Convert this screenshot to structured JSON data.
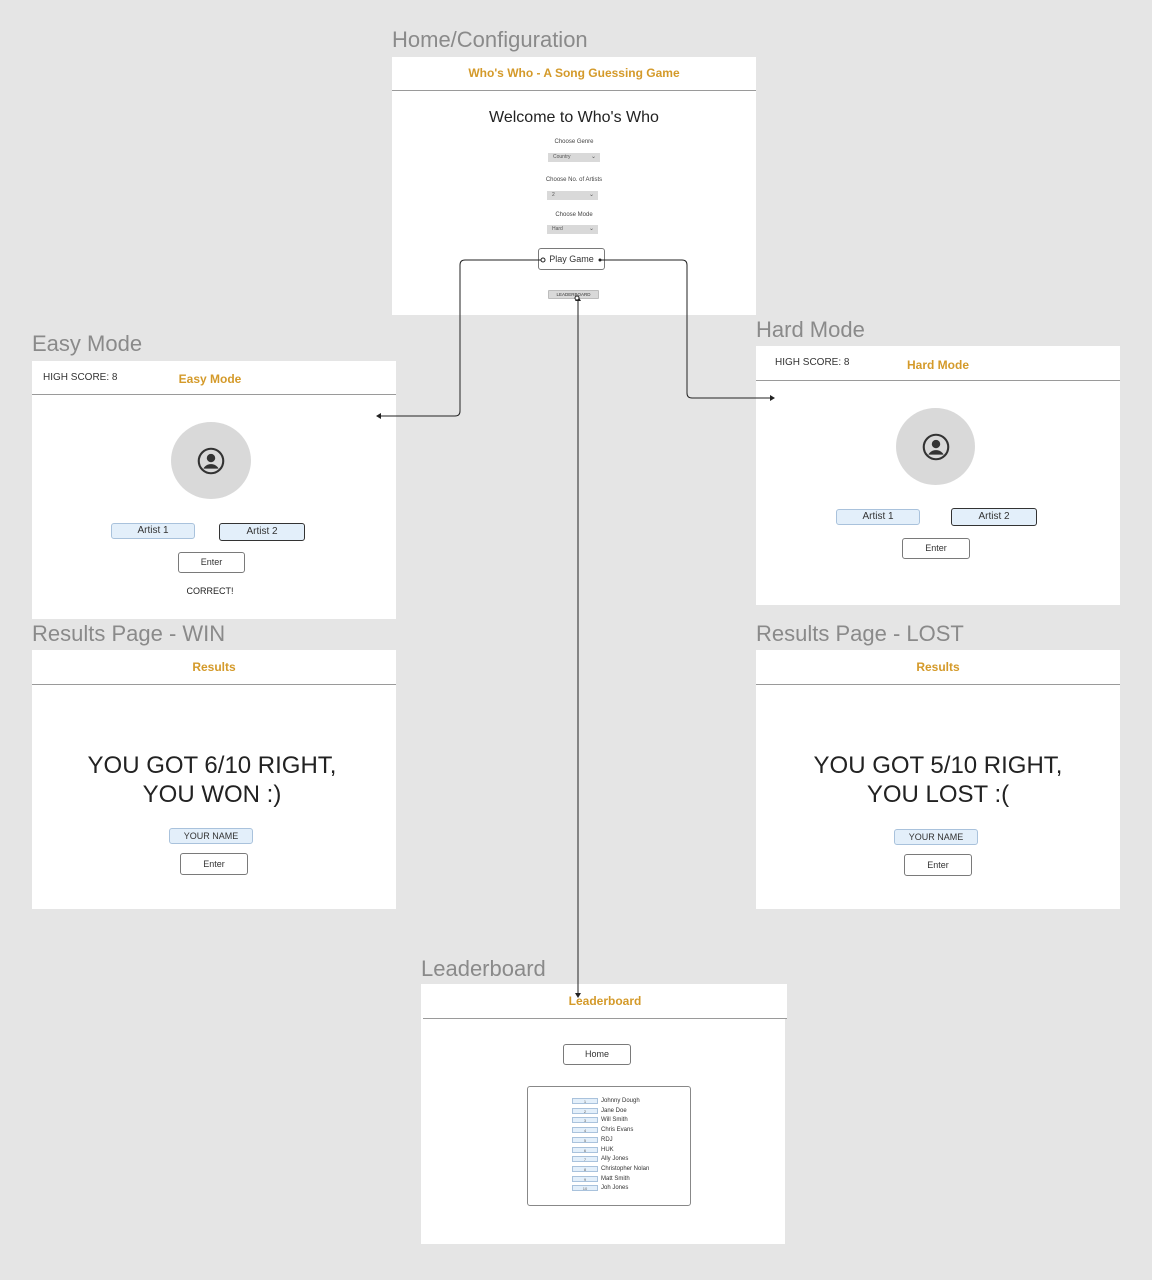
{
  "frames": {
    "home": {
      "label": "Home/Configuration",
      "header": "Who's Who - A Song Guessing Game",
      "welcome": "Welcome to Who's Who",
      "genre_label": "Choose Genre",
      "genre_value": "Country",
      "artists_label": "Choose No. of Artists",
      "artists_value": "2",
      "mode_label": "Choose Mode",
      "mode_value": "Hard",
      "play_button": "Play Game",
      "leaderboard_button": "LEADERBOARD"
    },
    "easy": {
      "label": "Easy Mode",
      "high_score": "HIGH SCORE: 8",
      "header": "Easy Mode",
      "artist1": "Artist 1",
      "artist2": "Artist 2",
      "enter": "Enter",
      "feedback": "CORRECT!"
    },
    "hard": {
      "label": "Hard Mode",
      "high_score": "HIGH SCORE: 8",
      "header": "Hard Mode",
      "artist1": "Artist 1",
      "artist2": "Artist 2",
      "enter": "Enter"
    },
    "win": {
      "label": "Results Page - WIN",
      "header": "Results",
      "line1": "YOU GOT 6/10 RIGHT,",
      "line2": "YOU WON :)",
      "name_field": "YOUR NAME",
      "enter": "Enter"
    },
    "lost": {
      "label": "Results Page - LOST",
      "header": "Results",
      "line1": "YOU GOT 5/10 RIGHT,",
      "line2": "YOU LOST :(",
      "name_field": "YOUR NAME",
      "enter": "Enter"
    },
    "leaderboard": {
      "label": "Leaderboard",
      "header": "Leaderboard",
      "home_button": "Home",
      "entries": [
        {
          "rank": "1",
          "name": "Johnny Dough"
        },
        {
          "rank": "2",
          "name": "Jane Doe"
        },
        {
          "rank": "3",
          "name": "Will Smith"
        },
        {
          "rank": "4",
          "name": "Chris Evans"
        },
        {
          "rank": "5",
          "name": "RDJ"
        },
        {
          "rank": "6",
          "name": "HUK"
        },
        {
          "rank": "7",
          "name": "Ally Jones"
        },
        {
          "rank": "8",
          "name": "Christopher Nolan"
        },
        {
          "rank": "9",
          "name": "Matt Smith"
        },
        {
          "rank": "10",
          "name": "Joh Jones"
        }
      ]
    }
  },
  "colors": {
    "canvas": "#e5e5e5",
    "accent": "#d49a2a",
    "chip_fill": "#e3effa"
  },
  "icons": {
    "avatar": "user-circle-icon"
  }
}
